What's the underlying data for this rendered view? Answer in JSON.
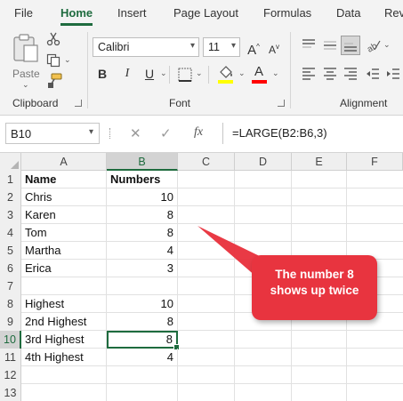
{
  "ribbon_tabs": [
    {
      "label": "File",
      "active": false
    },
    {
      "label": "Home",
      "active": true
    },
    {
      "label": "Insert",
      "active": false
    },
    {
      "label": "Page Layout",
      "active": false
    },
    {
      "label": "Formulas",
      "active": false
    },
    {
      "label": "Data",
      "active": false
    },
    {
      "label": "Rev",
      "active": false
    }
  ],
  "clipboard": {
    "paste_label": "Paste",
    "group_label": "Clipboard"
  },
  "font": {
    "name": "Calibri",
    "size": "11",
    "bold_label": "B",
    "italic_label": "I",
    "underline_label": "U",
    "fx_grow_label": "A",
    "fx_shrink_label": "A",
    "font_color_label": "A",
    "highlight_color": "#ffff00",
    "font_color": "#ff0000",
    "group_label": "Font"
  },
  "alignment": {
    "group_label": "Alignment"
  },
  "formula_bar": {
    "name_box": "B10",
    "cancel_label": "✕",
    "enter_label": "✓",
    "fx_label": "fx",
    "formula": "=LARGE(B2:B6,3)"
  },
  "grid": {
    "columns": [
      "A",
      "B",
      "C",
      "D",
      "E",
      "F"
    ],
    "selected_column": "B",
    "selected_row": "10",
    "active_cell": "B10",
    "rows": [
      {
        "num": "1",
        "a": "Name",
        "b": "Numbers"
      },
      {
        "num": "2",
        "a": "Chris",
        "b": "10"
      },
      {
        "num": "3",
        "a": "Karen",
        "b": "8"
      },
      {
        "num": "4",
        "a": "Tom",
        "b": "8"
      },
      {
        "num": "5",
        "a": "Martha",
        "b": "4"
      },
      {
        "num": "6",
        "a": "Erica",
        "b": "3"
      },
      {
        "num": "7",
        "a": "",
        "b": ""
      },
      {
        "num": "8",
        "a": "Highest",
        "b": "10"
      },
      {
        "num": "9",
        "a": "2nd Highest",
        "b": "8"
      },
      {
        "num": "10",
        "a": "3rd Highest",
        "b": "8"
      },
      {
        "num": "11",
        "a": "4th Highest",
        "b": "4"
      },
      {
        "num": "12",
        "a": "",
        "b": ""
      },
      {
        "num": "13",
        "a": "",
        "b": ""
      }
    ]
  },
  "callout": {
    "line1": "The number 8",
    "line2": "shows up twice",
    "color": "#e8343f"
  },
  "accent_color": "#1e6b3e"
}
